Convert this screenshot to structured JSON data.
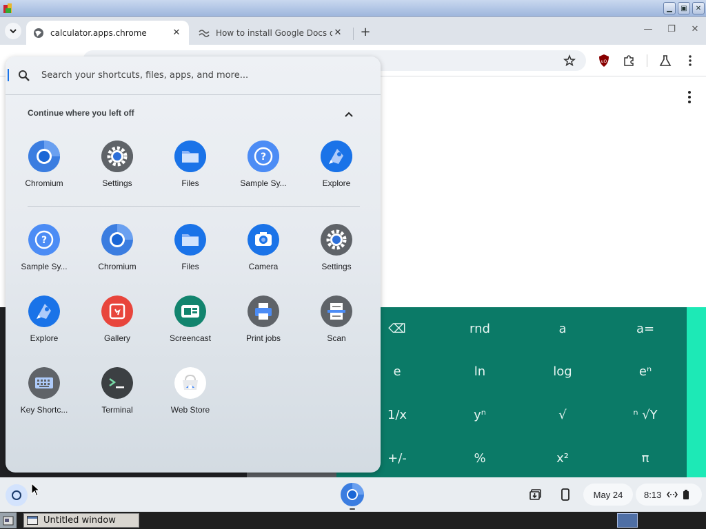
{
  "browser": {
    "tabs": [
      {
        "title": "calculator.apps.chrome",
        "active": true
      },
      {
        "title": "How to install Google Docs on",
        "active": false
      }
    ]
  },
  "calculator": {
    "keys": [
      [
        "⌫",
        "rnd",
        "a",
        "a="
      ],
      [
        "e",
        "ln",
        "log",
        "eⁿ"
      ],
      [
        "1/x",
        "yⁿ",
        "√",
        "ⁿ √Y"
      ],
      [
        "+/-",
        "%",
        "x²",
        "π"
      ]
    ],
    "colors": {
      "pad": "#0b7a67",
      "accent": "#1de9b6"
    }
  },
  "launcher": {
    "search_placeholder": "Search your shortcuts, files, apps, and more...",
    "continue_title": "Continue where you left off",
    "continue_apps": [
      {
        "label": "Chromium",
        "icon": "chromium-icon"
      },
      {
        "label": "Settings",
        "icon": "settings-icon"
      },
      {
        "label": "Files",
        "icon": "files-icon"
      },
      {
        "label": "Sample Sy...",
        "icon": "help-icon"
      },
      {
        "label": "Explore",
        "icon": "explore-icon"
      }
    ],
    "apps": [
      {
        "label": "Sample Sy...",
        "icon": "help-icon"
      },
      {
        "label": "Chromium",
        "icon": "chromium-icon"
      },
      {
        "label": "Files",
        "icon": "files-icon"
      },
      {
        "label": "Camera",
        "icon": "camera-icon"
      },
      {
        "label": "Settings",
        "icon": "settings-icon"
      },
      {
        "label": "Explore",
        "icon": "explore-icon"
      },
      {
        "label": "Gallery",
        "icon": "gallery-icon"
      },
      {
        "label": "Screencast",
        "icon": "screencast-icon"
      },
      {
        "label": "Print jobs",
        "icon": "print-icon"
      },
      {
        "label": "Scan",
        "icon": "scan-icon"
      },
      {
        "label": "Key Shortc...",
        "icon": "keyboard-icon"
      },
      {
        "label": "Terminal",
        "icon": "terminal-icon"
      },
      {
        "label": "Web Store",
        "icon": "webstore-icon"
      }
    ]
  },
  "shelf": {
    "date": "May 24",
    "time": "8:13"
  },
  "host": {
    "task_label": "Untitled window"
  }
}
